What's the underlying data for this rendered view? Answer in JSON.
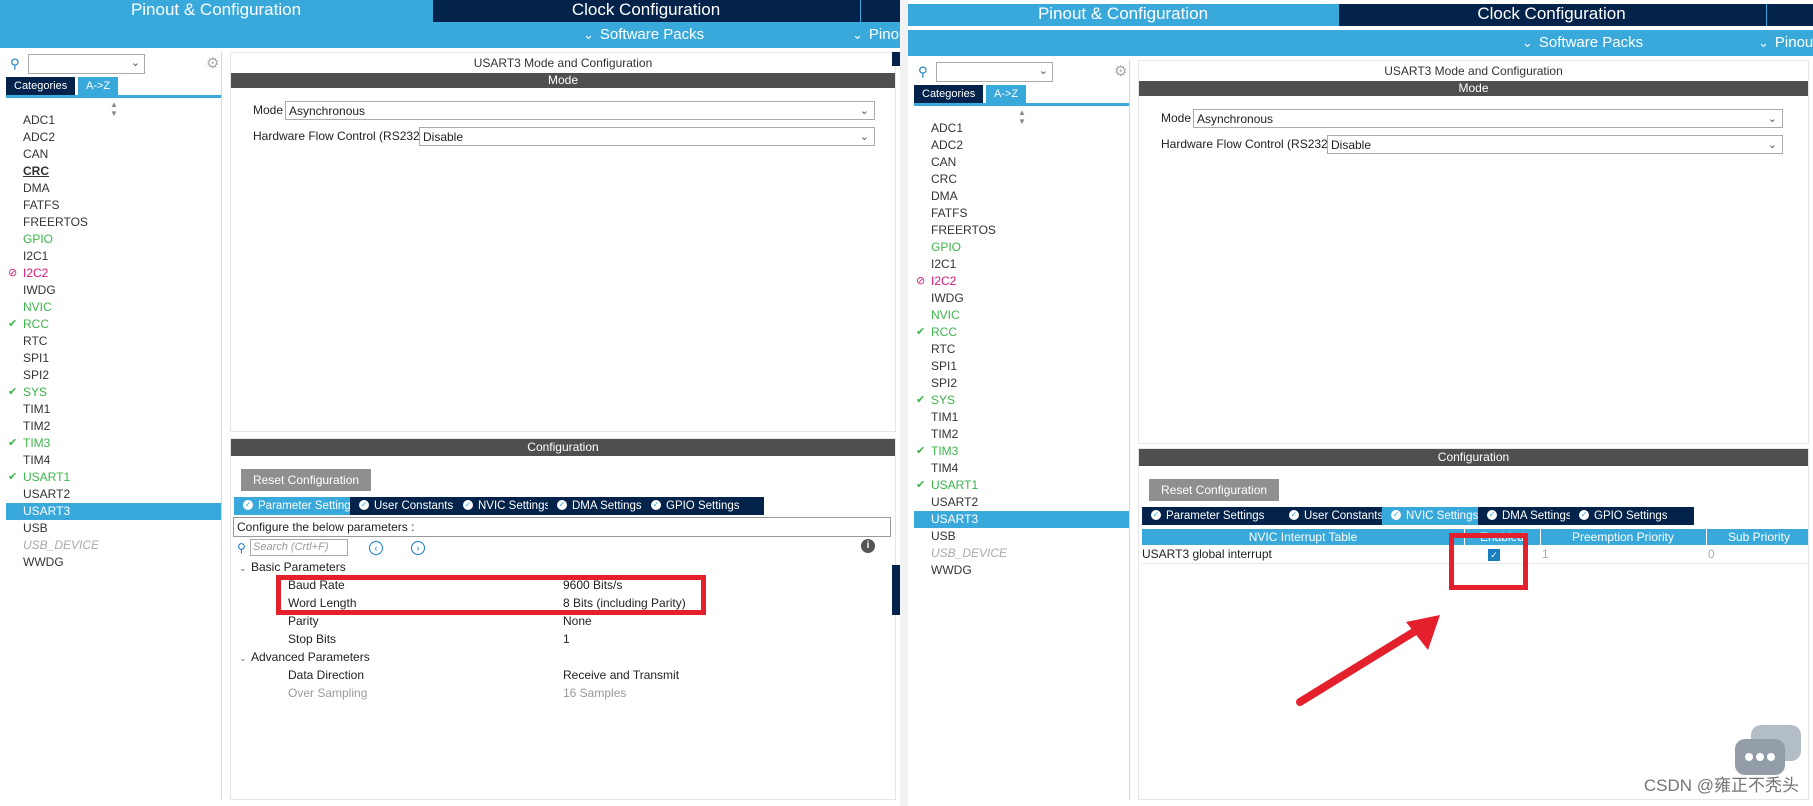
{
  "tabs": {
    "pinout": "Pinout & Configuration",
    "clock": "Clock Configuration",
    "pinout_cut": "Pinou"
  },
  "subbar": {
    "software_packs": "Software Packs"
  },
  "sidebar": {
    "categories_label": "Categories",
    "az_label": "A->Z",
    "peripherals": [
      {
        "name": "ADC1",
        "status": "normal"
      },
      {
        "name": "ADC2",
        "status": "normal"
      },
      {
        "name": "CAN",
        "status": "normal"
      },
      {
        "name": "CRC",
        "status": "normal"
      },
      {
        "name": "DMA",
        "status": "normal"
      },
      {
        "name": "FATFS",
        "status": "normal"
      },
      {
        "name": "FREERTOS",
        "status": "normal"
      },
      {
        "name": "GPIO",
        "status": "green"
      },
      {
        "name": "I2C1",
        "status": "normal"
      },
      {
        "name": "I2C2",
        "status": "conflict"
      },
      {
        "name": "IWDG",
        "status": "normal"
      },
      {
        "name": "NVIC",
        "status": "green"
      },
      {
        "name": "RCC",
        "status": "checked"
      },
      {
        "name": "RTC",
        "status": "normal"
      },
      {
        "name": "SPI1",
        "status": "normal"
      },
      {
        "name": "SPI2",
        "status": "normal"
      },
      {
        "name": "SYS",
        "status": "checked"
      },
      {
        "name": "TIM1",
        "status": "normal"
      },
      {
        "name": "TIM2",
        "status": "normal"
      },
      {
        "name": "TIM3",
        "status": "checked"
      },
      {
        "name": "TIM4",
        "status": "normal"
      },
      {
        "name": "USART1",
        "status": "checked"
      },
      {
        "name": "USART2",
        "status": "normal"
      },
      {
        "name": "USART3",
        "status": "selected"
      },
      {
        "name": "USB",
        "status": "normal"
      },
      {
        "name": "USB_DEVICE",
        "status": "disabled"
      },
      {
        "name": "WWDG",
        "status": "normal"
      }
    ]
  },
  "mode_pane": {
    "title": "USART3 Mode and Configuration",
    "band": "Mode",
    "mode_label": "Mode",
    "mode_value": "Asynchronous",
    "flow_label": "Hardware Flow Control (RS232)",
    "flow_value": "Disable"
  },
  "config_pane": {
    "band": "Configuration",
    "reset_label": "Reset Configuration",
    "tabs": [
      "Parameter Settings",
      "User Constants",
      "NVIC Settings",
      "DMA Settings",
      "GPIO Settings"
    ],
    "configure_text": "Configure the below parameters :",
    "search_placeholder": "Search (Crtl+F)",
    "basic_group": "Basic Parameters",
    "basic_params": [
      {
        "name": "Baud Rate",
        "value": "9600 Bits/s"
      },
      {
        "name": "Word Length",
        "value": "8 Bits (including Parity)"
      },
      {
        "name": "Parity",
        "value": "None"
      },
      {
        "name": "Stop Bits",
        "value": "1"
      }
    ],
    "advanced_group": "Advanced Parameters",
    "advanced_params": [
      {
        "name": "Data Direction",
        "value": "Receive and Transmit"
      },
      {
        "name": "Over Sampling",
        "value": "16 Samples"
      }
    ]
  },
  "nvic_table": {
    "headers": [
      "NVIC Interrupt Table",
      "Enabled",
      "Preemption Priority",
      "Sub Priority"
    ],
    "rows": [
      {
        "name": "USART3 global interrupt",
        "enabled": true,
        "preemption": "1",
        "sub": "0"
      }
    ]
  },
  "watermark": "CSDN @雍正不秃头",
  "colors": {
    "navy": "#03234b",
    "accent": "#39a9dc",
    "green": "#3db44a",
    "pink": "#d8177a",
    "highlight": "#e3202b"
  }
}
